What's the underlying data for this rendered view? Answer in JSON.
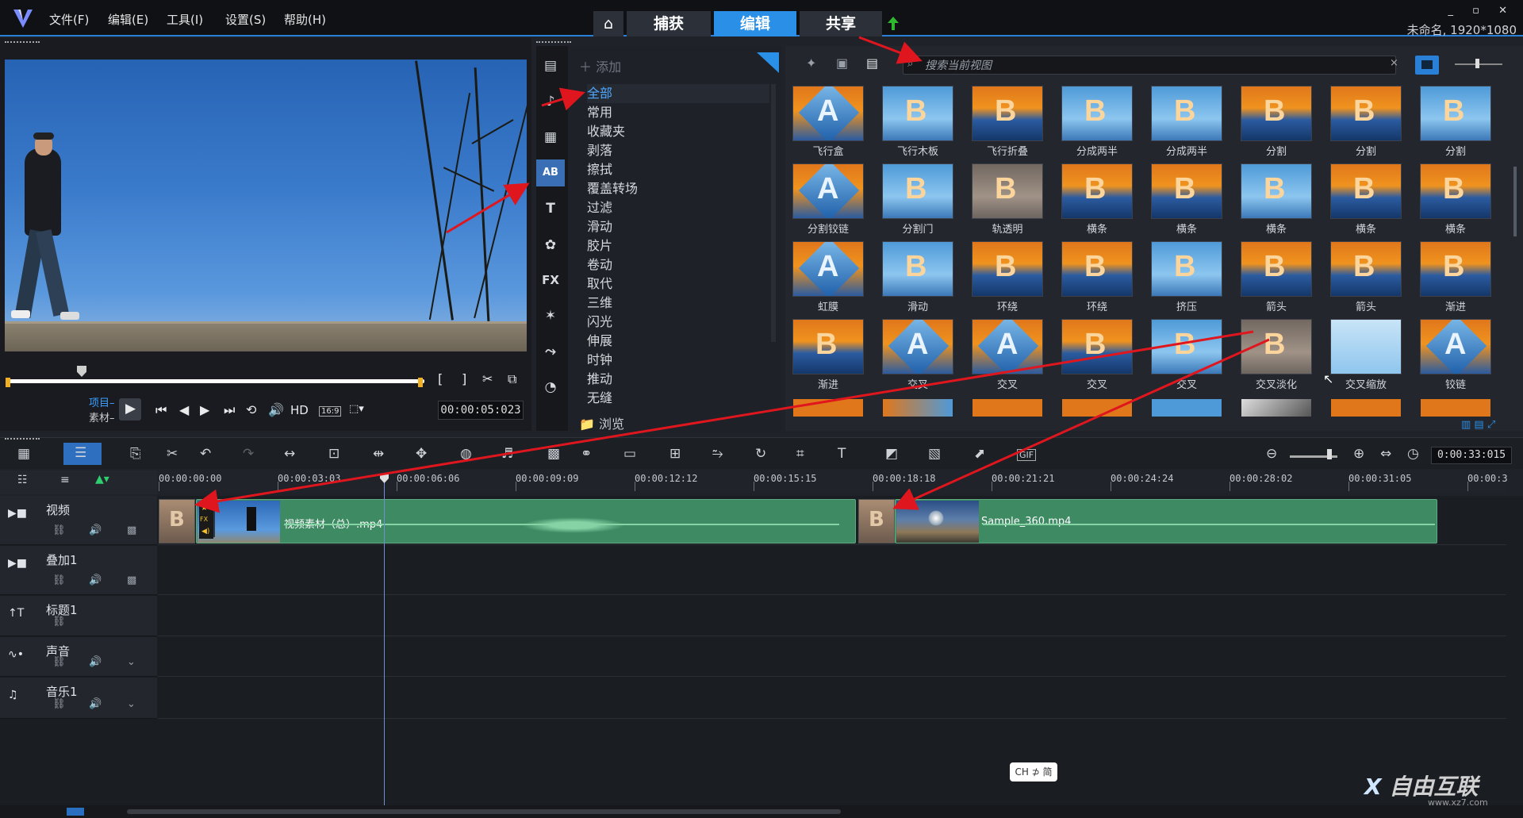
{
  "menu": [
    "文件(F)",
    "编辑(E)",
    "工具(I)",
    "设置(S)",
    "帮助(H)"
  ],
  "nav": {
    "home": "⌂",
    "capture": "捕获",
    "edit": "编辑",
    "share": "共享"
  },
  "window_controls": "_ ▫ ✕",
  "project_info": "未命名, 1920*1080",
  "preview": {
    "mode_project": "项目–",
    "mode_clip": "素材–",
    "hd": "HD",
    "ratio": "16:9",
    "timecode": "00:00:05:023"
  },
  "library": {
    "add_label": "添加",
    "categories": [
      "全部",
      "常用",
      "收藏夹",
      "剥落",
      "擦拭",
      "覆盖转场",
      "过滤",
      "滑动",
      "胶片",
      "卷动",
      "取代",
      "三维",
      "闪光",
      "伸展",
      "时钟",
      "推动",
      "无缝"
    ],
    "selected_category": "全部",
    "browse_label": "浏览",
    "search_placeholder": "搜索当前视图",
    "transitions": [
      "飞行盒",
      "飞行木板",
      "飞行折叠",
      "分成两半",
      "分成两半",
      "分割",
      "分割",
      "分割",
      "分割铰链",
      "分割门",
      "轨透明",
      "横条",
      "横条",
      "横条",
      "横条",
      "横条",
      "虹膜",
      "滑动",
      "环绕",
      "环绕",
      "挤压",
      "箭头",
      "箭头",
      "渐进",
      "渐进",
      "交叉",
      "交叉",
      "交叉",
      "交叉",
      "交叉淡化",
      "交叉缩放",
      "铰链"
    ]
  },
  "timeline": {
    "time_display": "0:00:33:015",
    "ruler": [
      "00:00:00:00",
      "00:00:03:03",
      "00:00:06:06",
      "00:00:09:09",
      "00:00:12:12",
      "00:00:15:15",
      "00:00:18:18",
      "00:00:21:21",
      "00:00:24:24",
      "00:00:28:02",
      "00:00:31:05",
      "00:00:3"
    ],
    "tracks": [
      "视频",
      "叠加1",
      "标题1",
      "声音",
      "音乐1"
    ],
    "clips": [
      {
        "name": "视频素材（总）.mp4"
      },
      {
        "name": "Sample_360.mp4"
      }
    ]
  },
  "ime": "CH ⊅ 简",
  "watermark": "自由互联",
  "watermark_url": "www.xz7.com",
  "accent": "#2a8fe6",
  "annotation_color": "#e0161e"
}
